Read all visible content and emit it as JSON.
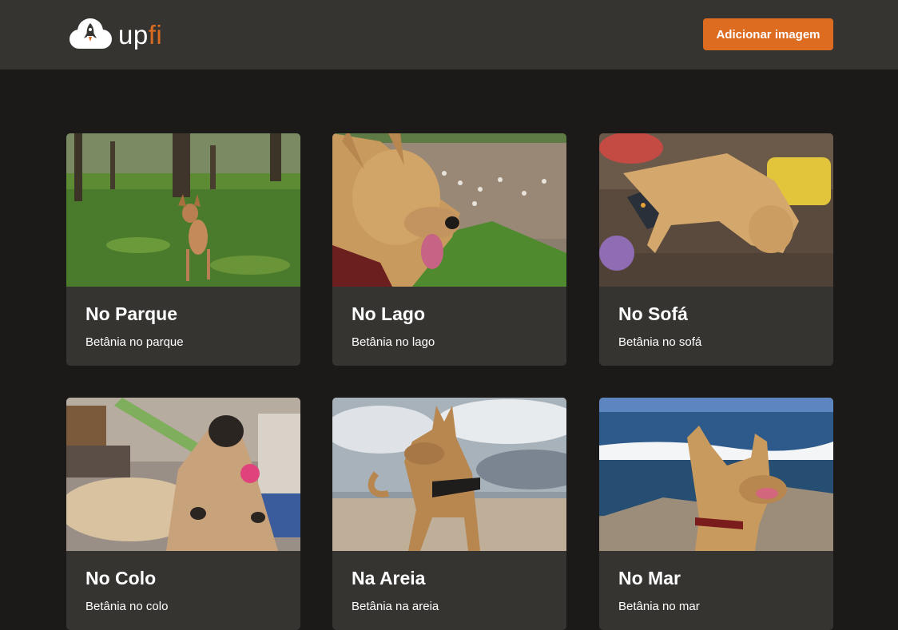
{
  "header": {
    "logo_text_a": "up",
    "logo_text_b": "fi",
    "logo_icon": "cloud-rocket-icon",
    "add_button_label": "Adicionar imagem"
  },
  "colors": {
    "accent": "#dd6b20",
    "background": "#1b1a19",
    "surface": "#353431",
    "text": "#ffffff"
  },
  "cards": [
    {
      "title": "No Parque",
      "description": "Betânia no parque"
    },
    {
      "title": "No Lago",
      "description": "Betânia no lago"
    },
    {
      "title": "No Sofá",
      "description": "Betânia no sofá"
    },
    {
      "title": "No Colo",
      "description": "Betânia no colo"
    },
    {
      "title": "Na Areia",
      "description": "Betânia na areia"
    },
    {
      "title": "No Mar",
      "description": "Betânia no mar"
    }
  ]
}
